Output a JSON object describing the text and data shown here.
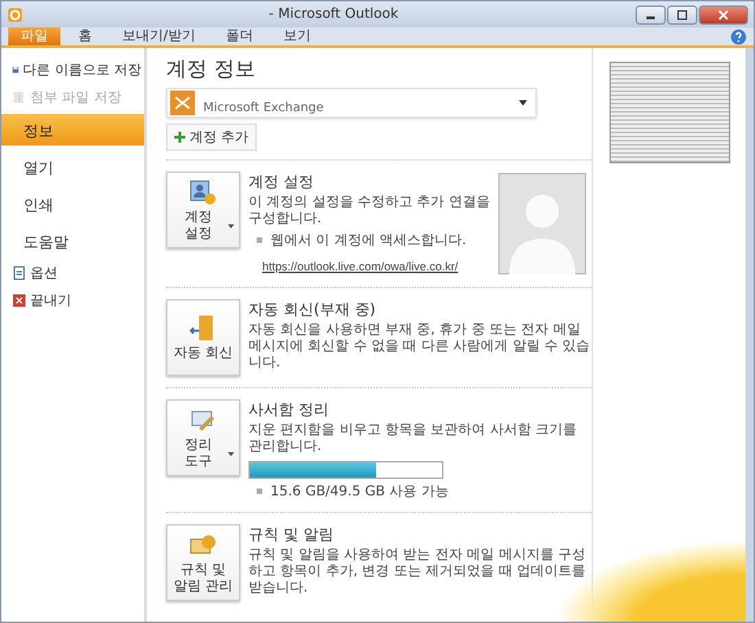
{
  "window": {
    "title": "- Microsoft Outlook"
  },
  "tabs": [
    {
      "label": "파일",
      "selected": true
    },
    {
      "label": "홈",
      "selected": false
    },
    {
      "label": "보내기/받기",
      "selected": false
    },
    {
      "label": "폴더",
      "selected": false
    },
    {
      "label": "보기",
      "selected": false
    }
  ],
  "sidebar": {
    "items": [
      {
        "kind": "command",
        "label": "다른 이름으로 저장",
        "disabled": false
      },
      {
        "kind": "command",
        "label": "첨부 파일 저장",
        "disabled": true
      },
      {
        "kind": "nav",
        "label": "정보",
        "disabled": false,
        "selected": true
      },
      {
        "kind": "nav",
        "label": "열기",
        "disabled": false,
        "selected": false
      },
      {
        "kind": "nav",
        "label": "인쇄",
        "disabled": false,
        "selected": false
      },
      {
        "kind": "nav",
        "label": "도움말",
        "disabled": false,
        "selected": false
      },
      {
        "kind": "command",
        "label": "옵션",
        "disabled": false
      },
      {
        "kind": "command",
        "label": "끝내기",
        "disabled": false
      }
    ]
  },
  "page": {
    "title": "계정 정보",
    "account": {
      "type": "Microsoft Exchange"
    },
    "add_account_button": "계정 추가"
  },
  "sections": [
    {
      "kind": "settings",
      "button": {
        "label": "계정 설정",
        "dropdown": true
      },
      "title": "계정 설정",
      "description": "이 계정의 설정을 수정하고 추가 연결을 구성합니다.",
      "bullet": "웹에서 이 계정에 액세스합니다.",
      "link": "https://outlook.live.com/owa/live.co.kr/"
    },
    {
      "kind": "reply",
      "button": {
        "label": "자동 회신",
        "dropdown": false
      },
      "title": "자동 회신(부재 중)",
      "description": "자동 회신을 사용하면 부재 중, 휴가 중 또는 전자 메일 메시지에 회신할 수 없을 때 다른 사람에게 알릴 수 있습니다."
    },
    {
      "kind": "cleanup",
      "button": {
        "label": "정리 도구",
        "dropdown": true
      },
      "title": "사서함 정리",
      "description": "지운 편지함을 비우고 항목을 보관하여 사서함 크기를 관리합니다.",
      "level": 0.66,
      "bullet": "15.6 GB/49.5 GB 사용 가능"
    },
    {
      "kind": "rules",
      "button": {
        "label": "규칙 및 알림 관리",
        "dropdown": false
      },
      "title": "규칙 및 알림",
      "description": "규칙 및 알림을 사용하여 받는 전자 메일 메시지를 구성하고 항목이 추가, 변경 또는 제거되었을 때 업데이트를 받습니다."
    }
  ]
}
